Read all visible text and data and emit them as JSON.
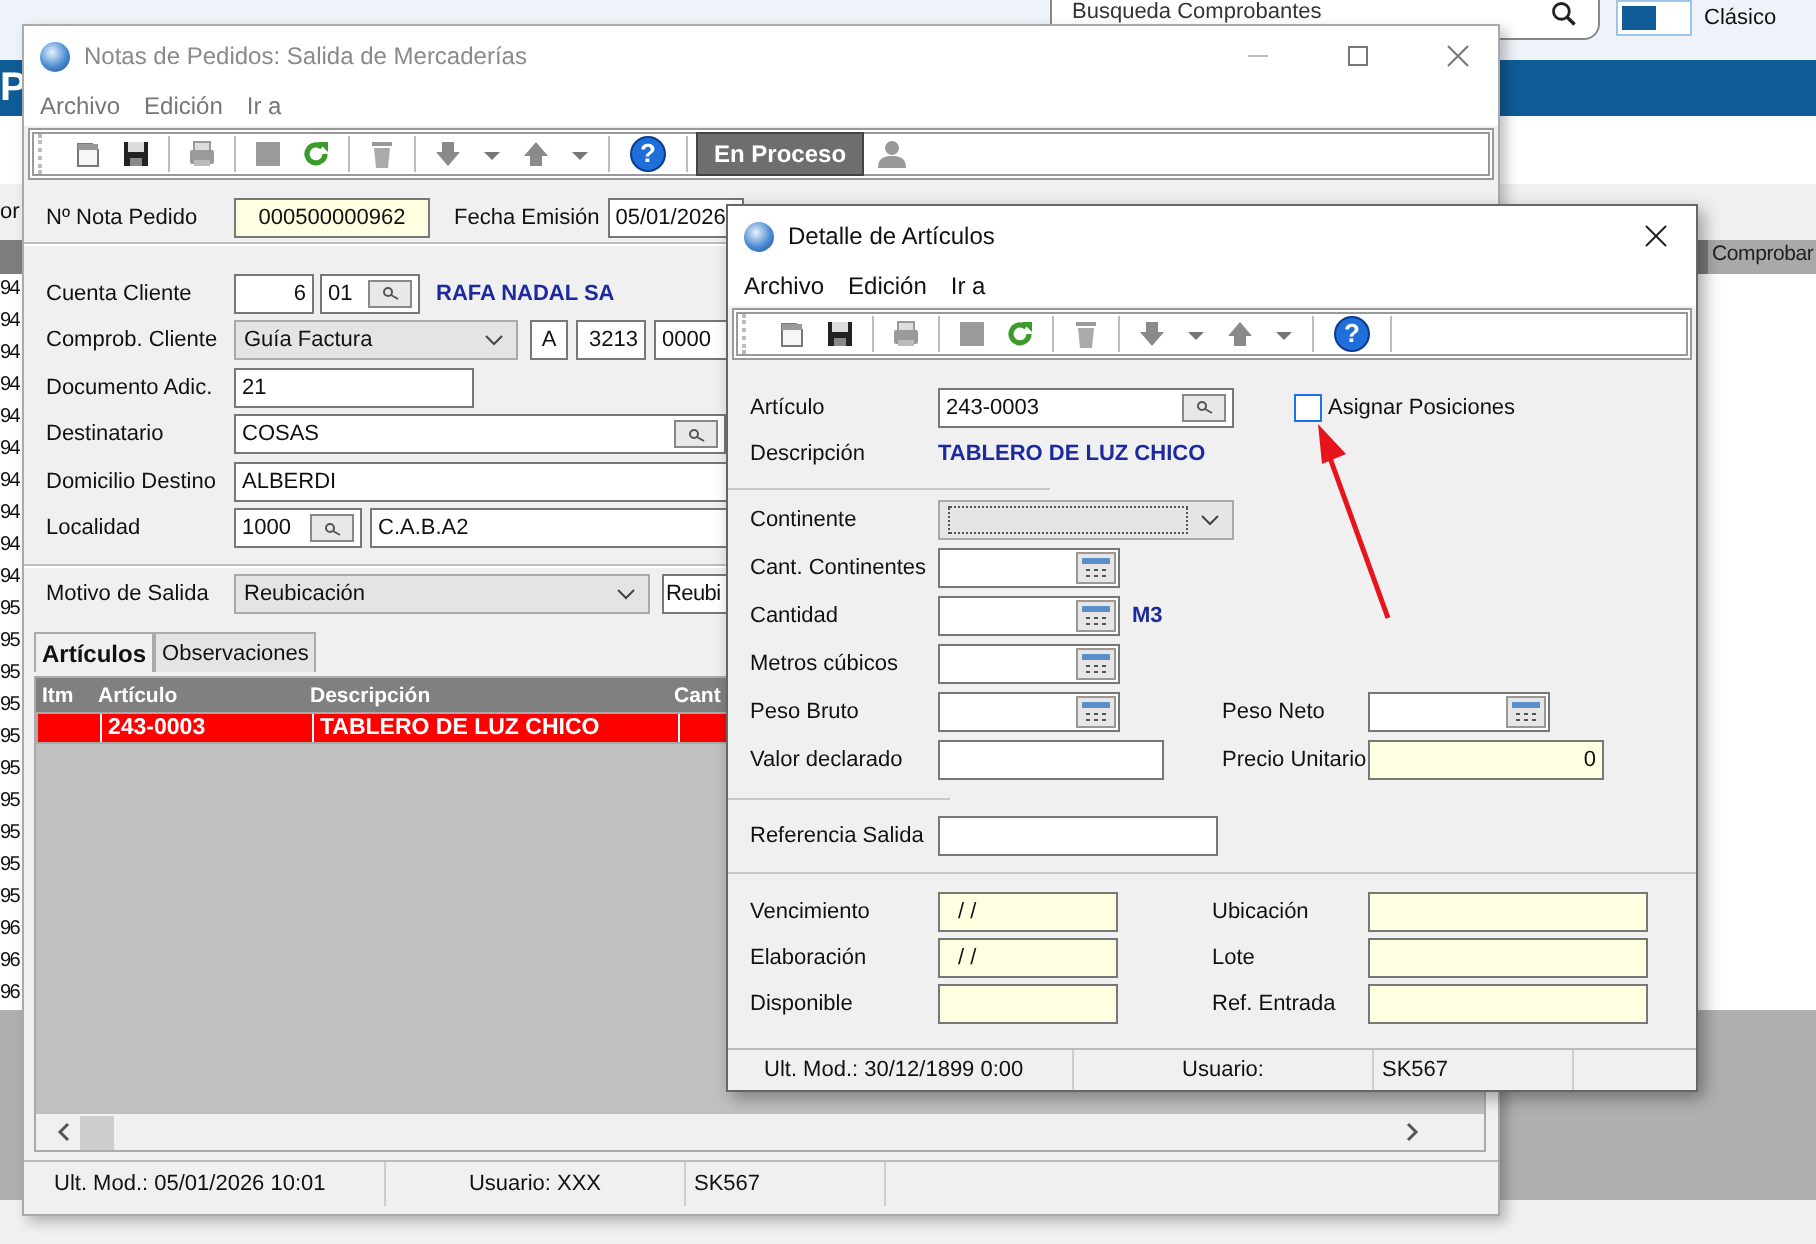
{
  "background_app": {
    "search": {
      "placeholder": "Busqueda Comprobantes"
    },
    "view_toggle": {
      "on": true,
      "label": "Clásico"
    },
    "header_text": "P",
    "left_label": "or",
    "right_header": "Comprobar",
    "left_list": [
      "94",
      "94",
      "94",
      "94",
      "94",
      "94",
      "94",
      "94",
      "94",
      "94",
      "95",
      "95",
      "95",
      "95",
      "95",
      "95",
      "95",
      "95",
      "95",
      "95",
      "96",
      "96",
      "96"
    ]
  },
  "orders_window": {
    "title": "Notas de Pedidos: Salida de Mercaderías",
    "menu": [
      "Archivo",
      "Edición",
      "Ir a"
    ],
    "help_glyph": "?",
    "status_label": "En Proceso",
    "nota": {
      "label": "Nº Nota Pedido",
      "value": "000500000962"
    },
    "fecha": {
      "label": "Fecha Emisión",
      "value": "05/01/2026"
    },
    "cuenta": {
      "label": "Cuenta Cliente",
      "number": "6",
      "branch": "01",
      "name": "RAFA NADAL SA"
    },
    "comprob": {
      "label": "Comprob. Cliente",
      "type": "Guía Factura",
      "letter": "A",
      "point": "3213",
      "number": "0000"
    },
    "documento": {
      "label": "Documento Adic.",
      "value": "21"
    },
    "destinatario": {
      "label": "Destinatario",
      "value": "COSAS"
    },
    "domicilio": {
      "label": "Domicilio Destino",
      "value": "ALBERDI"
    },
    "localidad": {
      "label": "Localidad",
      "code": "1000",
      "name": "C.A.B.A2"
    },
    "motivo": {
      "label": "Motivo de Salida",
      "value": "Reubicación",
      "extra": "Reubi"
    },
    "tabs": [
      {
        "label": "Artículos",
        "selected": true
      },
      {
        "label": "Observaciones",
        "selected": false
      }
    ],
    "grid": {
      "columns": [
        "Itm",
        "Artículo",
        "Descripción",
        "Cant"
      ],
      "rows": [
        {
          "articulo": "243-0003",
          "descripcion": "TABLERO DE LUZ CHICO",
          "selected": true
        }
      ]
    },
    "status_bar": [
      "Ult. Mod.: 05/01/2026 10:01",
      "Usuario: XXX",
      "SK567"
    ]
  },
  "detail_window": {
    "title": "Detalle de Artículos",
    "menu": [
      "Archivo",
      "Edición",
      "Ir a"
    ],
    "help_glyph": "?",
    "articulo": {
      "label": "Artículo",
      "value": "243-0003"
    },
    "asignar": {
      "label": "Asignar Posiciones",
      "checked": false
    },
    "descripcion": {
      "label": "Descripción",
      "value": "TABLERO DE LUZ CHICO"
    },
    "continente": {
      "label": "Continente",
      "disabled": true
    },
    "measure_rows": [
      {
        "left": {
          "label": "Cant. Continentes",
          "kind": "calc",
          "readonly": false
        }
      },
      {
        "left": {
          "label": "Cantidad",
          "kind": "calc",
          "readonly": false
        },
        "unit": "M3"
      },
      {
        "left": {
          "label": "Metros cúbicos",
          "kind": "calc",
          "readonly": false
        }
      },
      {
        "left": {
          "label": "Peso Bruto",
          "kind": "calc",
          "readonly": false
        },
        "right": {
          "label": "Peso Neto",
          "kind": "calc",
          "readonly": false
        }
      },
      {
        "left": {
          "label": "Valor declarado",
          "kind": "text",
          "readonly": false
        },
        "right": {
          "label": "Precio Unitario",
          "kind": "number",
          "value": "0",
          "readonly": true
        }
      }
    ],
    "referencia": {
      "label": "Referencia Salida",
      "readonly": false
    },
    "lot_rows": [
      {
        "left": {
          "label": "Vencimiento",
          "value": "/ /",
          "readonly": true
        },
        "right": {
          "label": "Ubicación",
          "readonly": true
        }
      },
      {
        "left": {
          "label": "Elaboración",
          "value": "/ /",
          "readonly": true
        },
        "right": {
          "label": "Lote",
          "readonly": true
        }
      },
      {
        "left": {
          "label": "Disponible",
          "readonly": true
        },
        "right": {
          "label": "Ref. Entrada",
          "readonly": true
        }
      }
    ],
    "status_bar": [
      "Ult. Mod.: 30/12/1899 0:00",
      "Usuario:",
      "SK567"
    ]
  }
}
